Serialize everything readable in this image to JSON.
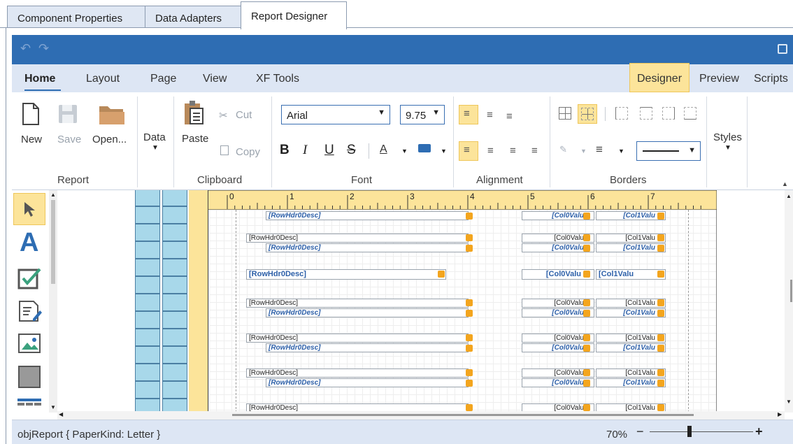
{
  "outer_tabs": [
    "Component Properties",
    "Data Adapters",
    "Report Designer"
  ],
  "ribbon_tabs": [
    "Home",
    "Layout",
    "Page",
    "View",
    "XF Tools"
  ],
  "ribbon_right_tabs": [
    "Designer",
    "Preview",
    "Scripts"
  ],
  "report_group": {
    "new": "New",
    "save": "Save",
    "open": "Open...",
    "label": "Report"
  },
  "data_button": "Data",
  "clipboard": {
    "paste": "Paste",
    "cut": "Cut",
    "copy": "Copy",
    "label": "Clipboard"
  },
  "font": {
    "name": "Arial",
    "size": "9.75",
    "label": "Font",
    "bold": "B",
    "italic": "I",
    "underline": "U",
    "strike": "S",
    "color": "A"
  },
  "alignment_label": "Alignment",
  "borders_label": "Borders",
  "styles_button": "Styles",
  "ruler_marks": [
    "0",
    "1",
    "2",
    "3",
    "4",
    "5",
    "6",
    "7"
  ],
  "rows": [
    {
      "hdr": "[RowHdr0Desc]",
      "c0": "[Col0Valu",
      "c1": "[Col1Valu"
    }
  ],
  "status": {
    "text": "objReport { PaperKind: Letter }",
    "zoom": "70%",
    "minus": "−",
    "plus": "+"
  },
  "colors": {
    "accent": "#2e6db3",
    "highlight": "#fce49a",
    "band": "#a8d8ea",
    "ruler": "#fce49a"
  }
}
